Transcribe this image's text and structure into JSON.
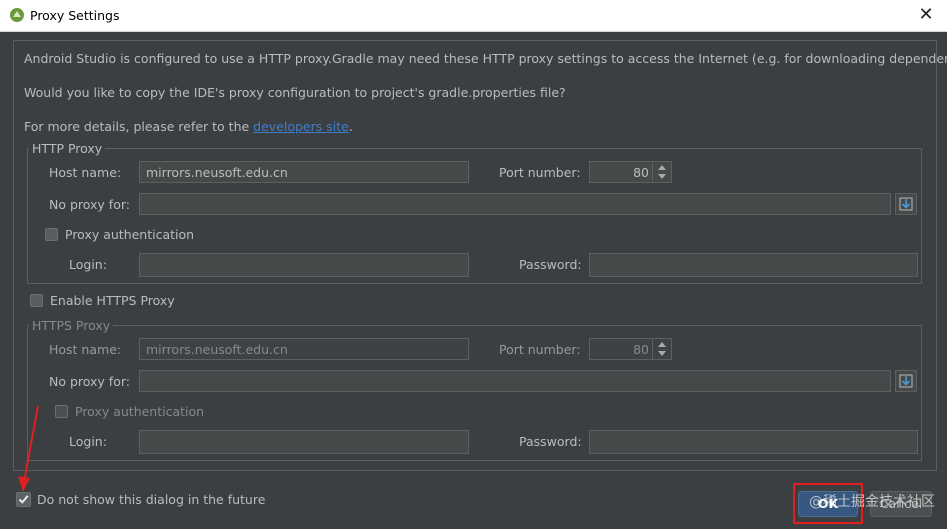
{
  "window": {
    "title": "Proxy Settings",
    "close_symbol": "✕"
  },
  "intro": {
    "line1": "Android Studio is configured to use a HTTP proxy.Gradle may need these HTTP proxy settings to access the Internet (e.g. for downloading dependencies.)",
    "line2": "Would you like to copy the IDE's proxy configuration to project's gradle.properties file?",
    "line3_prefix": "For more details, please refer to the ",
    "line3_link": "developers site",
    "line3_suffix": "."
  },
  "http_proxy": {
    "title": "HTTP Proxy",
    "host_label": "Host name:",
    "host_value": "mirrors.neusoft.edu.cn",
    "port_label": "Port number:",
    "port_value": "80",
    "no_proxy_label": "No proxy for:",
    "no_proxy_value": "",
    "auth_label": "Proxy authentication",
    "auth_checked": false,
    "login_label": "Login:",
    "login_value": "",
    "password_label": "Password:",
    "password_value": ""
  },
  "enable_https": {
    "label": "Enable HTTPS Proxy",
    "checked": false
  },
  "https_proxy": {
    "title": "HTTPS Proxy",
    "host_label": "Host name:",
    "host_value": "mirrors.neusoft.edu.cn",
    "port_label": "Port number:",
    "port_value": "80",
    "no_proxy_label": "No proxy for:",
    "no_proxy_value": "",
    "auth_label": "Proxy authentication",
    "auth_checked": false,
    "login_label": "Login:",
    "login_value": "",
    "password_label": "Password:",
    "password_value": ""
  },
  "footer": {
    "dont_show_label": "Do not show this dialog in the future",
    "dont_show_checked": true,
    "ok_label": "OK",
    "cancel_label": "Cancel"
  },
  "watermark": "@稀土掘金技术社区",
  "colors": {
    "background": "#3c3f41",
    "accent_button": "#365880",
    "link": "#3c7ed0",
    "annotation": "#e02020"
  }
}
